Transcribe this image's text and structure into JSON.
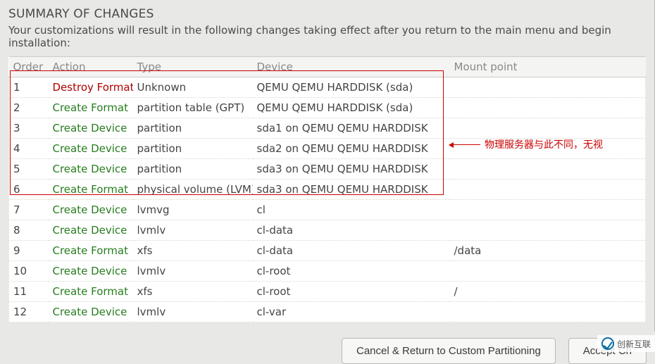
{
  "title": "SUMMARY OF CHANGES",
  "subtitle": "Your customizations will result in the following changes taking effect after you return to the main menu and begin installation:",
  "columns": {
    "order": "Order",
    "action": "Action",
    "type": "Type",
    "device": "Device",
    "mount": "Mount point"
  },
  "rows": [
    {
      "order": "1",
      "action": "Destroy Format",
      "action_kind": "destroy",
      "type": "Unknown",
      "device": "QEMU QEMU HARDDISK (sda)",
      "mount": ""
    },
    {
      "order": "2",
      "action": "Create Format",
      "action_kind": "create",
      "type": "partition table (GPT)",
      "device": "QEMU QEMU HARDDISK (sda)",
      "mount": ""
    },
    {
      "order": "3",
      "action": "Create Device",
      "action_kind": "create",
      "type": "partition",
      "device": "sda1 on QEMU QEMU HARDDISK",
      "mount": ""
    },
    {
      "order": "4",
      "action": "Create Device",
      "action_kind": "create",
      "type": "partition",
      "device": "sda2 on QEMU QEMU HARDDISK",
      "mount": ""
    },
    {
      "order": "5",
      "action": "Create Device",
      "action_kind": "create",
      "type": "partition",
      "device": "sda3 on QEMU QEMU HARDDISK",
      "mount": ""
    },
    {
      "order": "6",
      "action": "Create Format",
      "action_kind": "create",
      "type": "physical volume (LVM)",
      "device": "sda3 on QEMU QEMU HARDDISK",
      "mount": ""
    },
    {
      "order": "7",
      "action": "Create Device",
      "action_kind": "create",
      "type": "lvmvg",
      "device": "cl",
      "mount": ""
    },
    {
      "order": "8",
      "action": "Create Device",
      "action_kind": "create",
      "type": "lvmlv",
      "device": "cl-data",
      "mount": ""
    },
    {
      "order": "9",
      "action": "Create Format",
      "action_kind": "create",
      "type": "xfs",
      "device": "cl-data",
      "mount": "/data"
    },
    {
      "order": "10",
      "action": "Create Device",
      "action_kind": "create",
      "type": "lvmlv",
      "device": "cl-root",
      "mount": ""
    },
    {
      "order": "11",
      "action": "Create Format",
      "action_kind": "create",
      "type": "xfs",
      "device": "cl-root",
      "mount": "/"
    },
    {
      "order": "12",
      "action": "Create Device",
      "action_kind": "create",
      "type": "lvmlv",
      "device": "cl-var",
      "mount": ""
    }
  ],
  "annotation": "物理服务器与此不同，无视",
  "buttons": {
    "cancel": "Cancel & Return to Custom Partitioning",
    "accept": "Accept Ch"
  },
  "watermark": "创新互联"
}
